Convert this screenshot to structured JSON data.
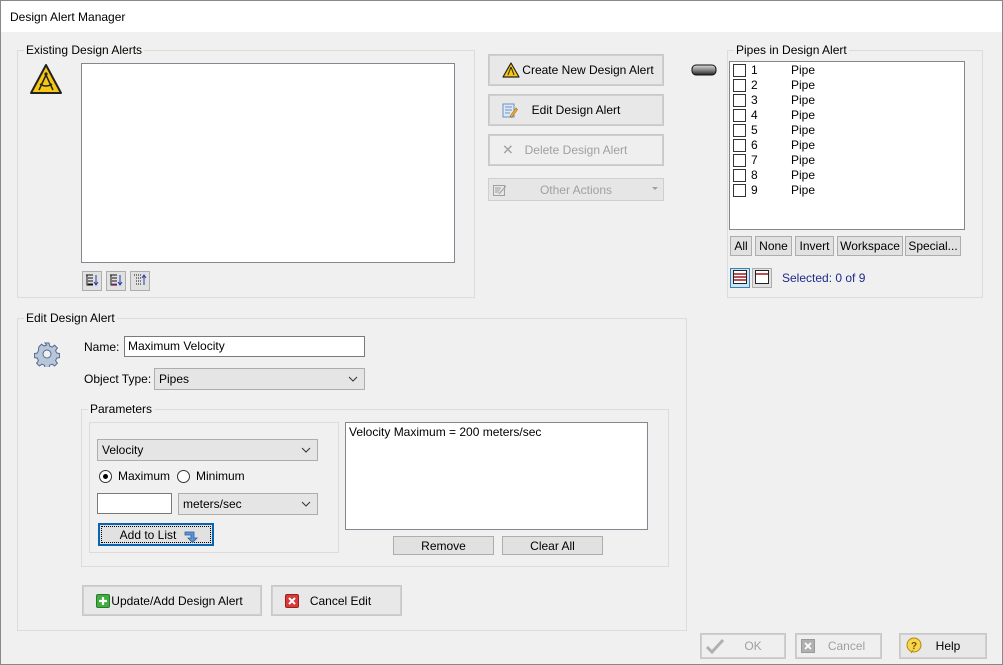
{
  "window": {
    "title": "Design Alert Manager"
  },
  "existing": {
    "group_label": "Existing Design Alerts",
    "items": [],
    "sort_buttons": [
      {
        "icon": "sort-ascending-icon"
      },
      {
        "icon": "sort-custom-icon"
      },
      {
        "icon": "sort-descending-icon"
      }
    ]
  },
  "actions": {
    "create_label": "Create New Design Alert",
    "edit_label": "Edit Design Alert",
    "delete_label": "Delete Design Alert",
    "other_label": "Other Actions"
  },
  "pipes": {
    "group_label": "Pipes in Design Alert",
    "rows": [
      {
        "id": "1",
        "type": "Pipe",
        "checked": false
      },
      {
        "id": "2",
        "type": "Pipe",
        "checked": false
      },
      {
        "id": "3",
        "type": "Pipe",
        "checked": false
      },
      {
        "id": "4",
        "type": "Pipe",
        "checked": false
      },
      {
        "id": "5",
        "type": "Pipe",
        "checked": false
      },
      {
        "id": "6",
        "type": "Pipe",
        "checked": false
      },
      {
        "id": "7",
        "type": "Pipe",
        "checked": false
      },
      {
        "id": "8",
        "type": "Pipe",
        "checked": false
      },
      {
        "id": "9",
        "type": "Pipe",
        "checked": false
      }
    ],
    "buttons": {
      "all": "All",
      "none": "None",
      "invert": "Invert",
      "workspace": "Workspace",
      "special": "Special..."
    },
    "selected_text": "Selected: 0 of 9"
  },
  "edit": {
    "group_label": "Edit Design Alert",
    "name_label": "Name:",
    "name_value": "Maximum Velocity",
    "object_type_label": "Object Type:",
    "object_type_value": "Pipes",
    "parameters": {
      "group_label": "Parameters",
      "parameter_value": "Velocity",
      "maximum_label": "Maximum",
      "minimum_label": "Minimum",
      "selected_limit": "Maximum",
      "value_input": "",
      "unit_value": "meters/sec",
      "add_label": "Add to List",
      "list_items": [
        "Velocity Maximum = 200 meters/sec"
      ],
      "remove_label": "Remove",
      "clear_label": "Clear All"
    },
    "update_label": "Update/Add Design Alert",
    "cancel_edit_label": "Cancel Edit"
  },
  "footer": {
    "ok_label": "OK",
    "cancel_label": "Cancel",
    "help_label": "Help"
  }
}
